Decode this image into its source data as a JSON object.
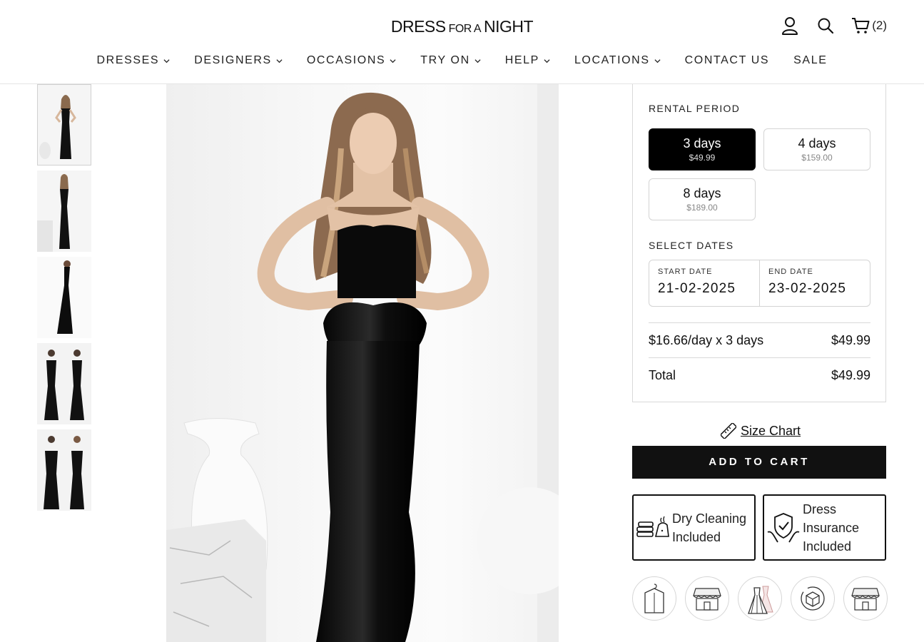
{
  "header": {
    "logo_big_1": "DRESS",
    "logo_small": "FOR A",
    "logo_big_2": "NIGHT",
    "cart_count": "(2)"
  },
  "nav": {
    "items": [
      {
        "label": "DRESSES",
        "dropdown": true
      },
      {
        "label": "DESIGNERS",
        "dropdown": true
      },
      {
        "label": "OCCASIONS",
        "dropdown": true
      },
      {
        "label": "TRY ON",
        "dropdown": true
      },
      {
        "label": "HELP",
        "dropdown": true
      },
      {
        "label": "LOCATIONS",
        "dropdown": true
      },
      {
        "label": "CONTACT US",
        "dropdown": false
      },
      {
        "label": "SALE",
        "dropdown": false
      }
    ]
  },
  "gallery": {
    "thumbnail_count": 5,
    "selected_index": 0
  },
  "rental": {
    "period_label": "RENTAL PERIOD",
    "options": [
      {
        "days": "3 days",
        "price": "$49.99",
        "selected": true
      },
      {
        "days": "4 days",
        "price": "$159.00",
        "selected": false
      },
      {
        "days": "8 days",
        "price": "$189.00",
        "selected": false
      }
    ],
    "dates_label": "SELECT DATES",
    "start_label": "START DATE",
    "start_value": "21-02-2025",
    "end_label": "END DATE",
    "end_value": "23-02-2025",
    "rate_label": "$16.66/day x 3 days",
    "rate_value": "$49.99",
    "total_label": "Total",
    "total_value": "$49.99"
  },
  "actions": {
    "size_chart": "Size Chart",
    "add_to_cart": "ADD TO CART"
  },
  "features": {
    "dry_cleaning": [
      "Dry Cleaning",
      "Included"
    ],
    "insurance": [
      "Dress",
      "Insurance",
      "Included"
    ]
  },
  "badges": [
    "garment-bag-icon",
    "storefront-icon",
    "dresses-icon",
    "box-return-icon",
    "storefront-icon"
  ],
  "colors": {
    "accent": "#000000",
    "border": "#d4d4d4"
  }
}
